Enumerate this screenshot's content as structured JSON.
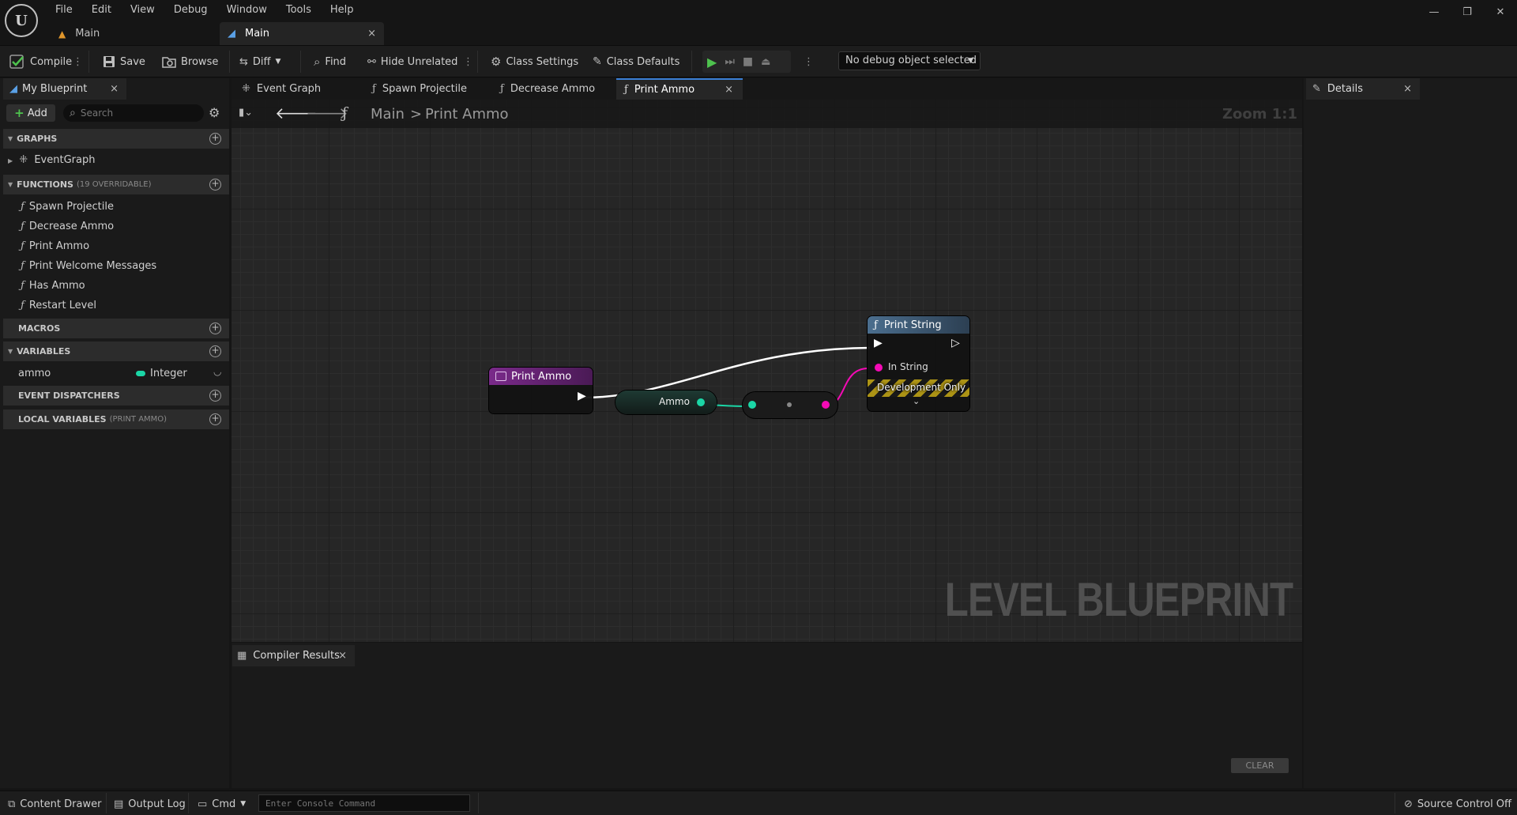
{
  "app": {
    "logo_text": "U"
  },
  "menu": [
    "File",
    "Edit",
    "View",
    "Debug",
    "Window",
    "Tools",
    "Help"
  ],
  "window_controls": {
    "minimize": "—",
    "restore": "❐",
    "close": "✕"
  },
  "doc_tabs": [
    {
      "label": "Main",
      "active": false
    },
    {
      "label": "Main",
      "active": true,
      "close": "×"
    }
  ],
  "toolbar": {
    "compile": "Compile",
    "save": "Save",
    "browse": "Browse",
    "diff": "Diff",
    "find": "Find",
    "hide_unrelated": "Hide Unrelated",
    "class_settings": "Class Settings",
    "class_defaults": "Class Defaults",
    "debug_object": "No debug object selected"
  },
  "my_blueprint": {
    "tab_label": "My Blueprint",
    "add_label": "Add",
    "search_placeholder": "Search",
    "sections": {
      "graphs": "GRAPHS",
      "functions": "FUNCTIONS",
      "functions_note": "(19 OVERRIDABLE)",
      "macros": "MACROS",
      "variables": "VARIABLES",
      "event_dispatchers": "EVENT DISPATCHERS",
      "local_variables": "LOCAL VARIABLES",
      "local_variables_note": "(PRINT AMMO)"
    },
    "graphs": [
      "EventGraph"
    ],
    "functions": [
      "Spawn Projectile",
      "Decrease Ammo",
      "Print Ammo",
      "Print Welcome Messages",
      "Has Ammo",
      "Restart Level"
    ],
    "variables": [
      {
        "name": "ammo",
        "type": "Integer",
        "color": "#1bd6a6"
      }
    ]
  },
  "graph_tabs": [
    "Event Graph",
    "Spawn Projectile",
    "Decrease Ammo",
    "Print Ammo"
  ],
  "graph": {
    "breadcrumb_root": "Main",
    "breadcrumb_sep": ">",
    "breadcrumb_current": "Print Ammo",
    "zoom": "Zoom 1:1",
    "watermark": "LEVEL BLUEPRINT",
    "nodes": {
      "entry_title": "Print Ammo",
      "ammo_label": "Ammo",
      "print_string_title": "Print String",
      "in_string_label": "In String",
      "dev_only_label": "Development Only"
    }
  },
  "compiler": {
    "tab_label": "Compiler Results",
    "clear_label": "CLEAR"
  },
  "details": {
    "tab_label": "Details"
  },
  "statusbar": {
    "content_drawer": "Content Drawer",
    "output_log": "Output Log",
    "cmd": "Cmd",
    "console_placeholder": "Enter Console Command",
    "source_control": "Source Control Off"
  },
  "colors": {
    "exec": "#ffffff",
    "integer_pin": "#1bd6a6",
    "string_pin": "#f40ab5",
    "function_head": "#4b6e8e",
    "event_head": "#7a2a8a",
    "play_green": "#4ec24e"
  }
}
